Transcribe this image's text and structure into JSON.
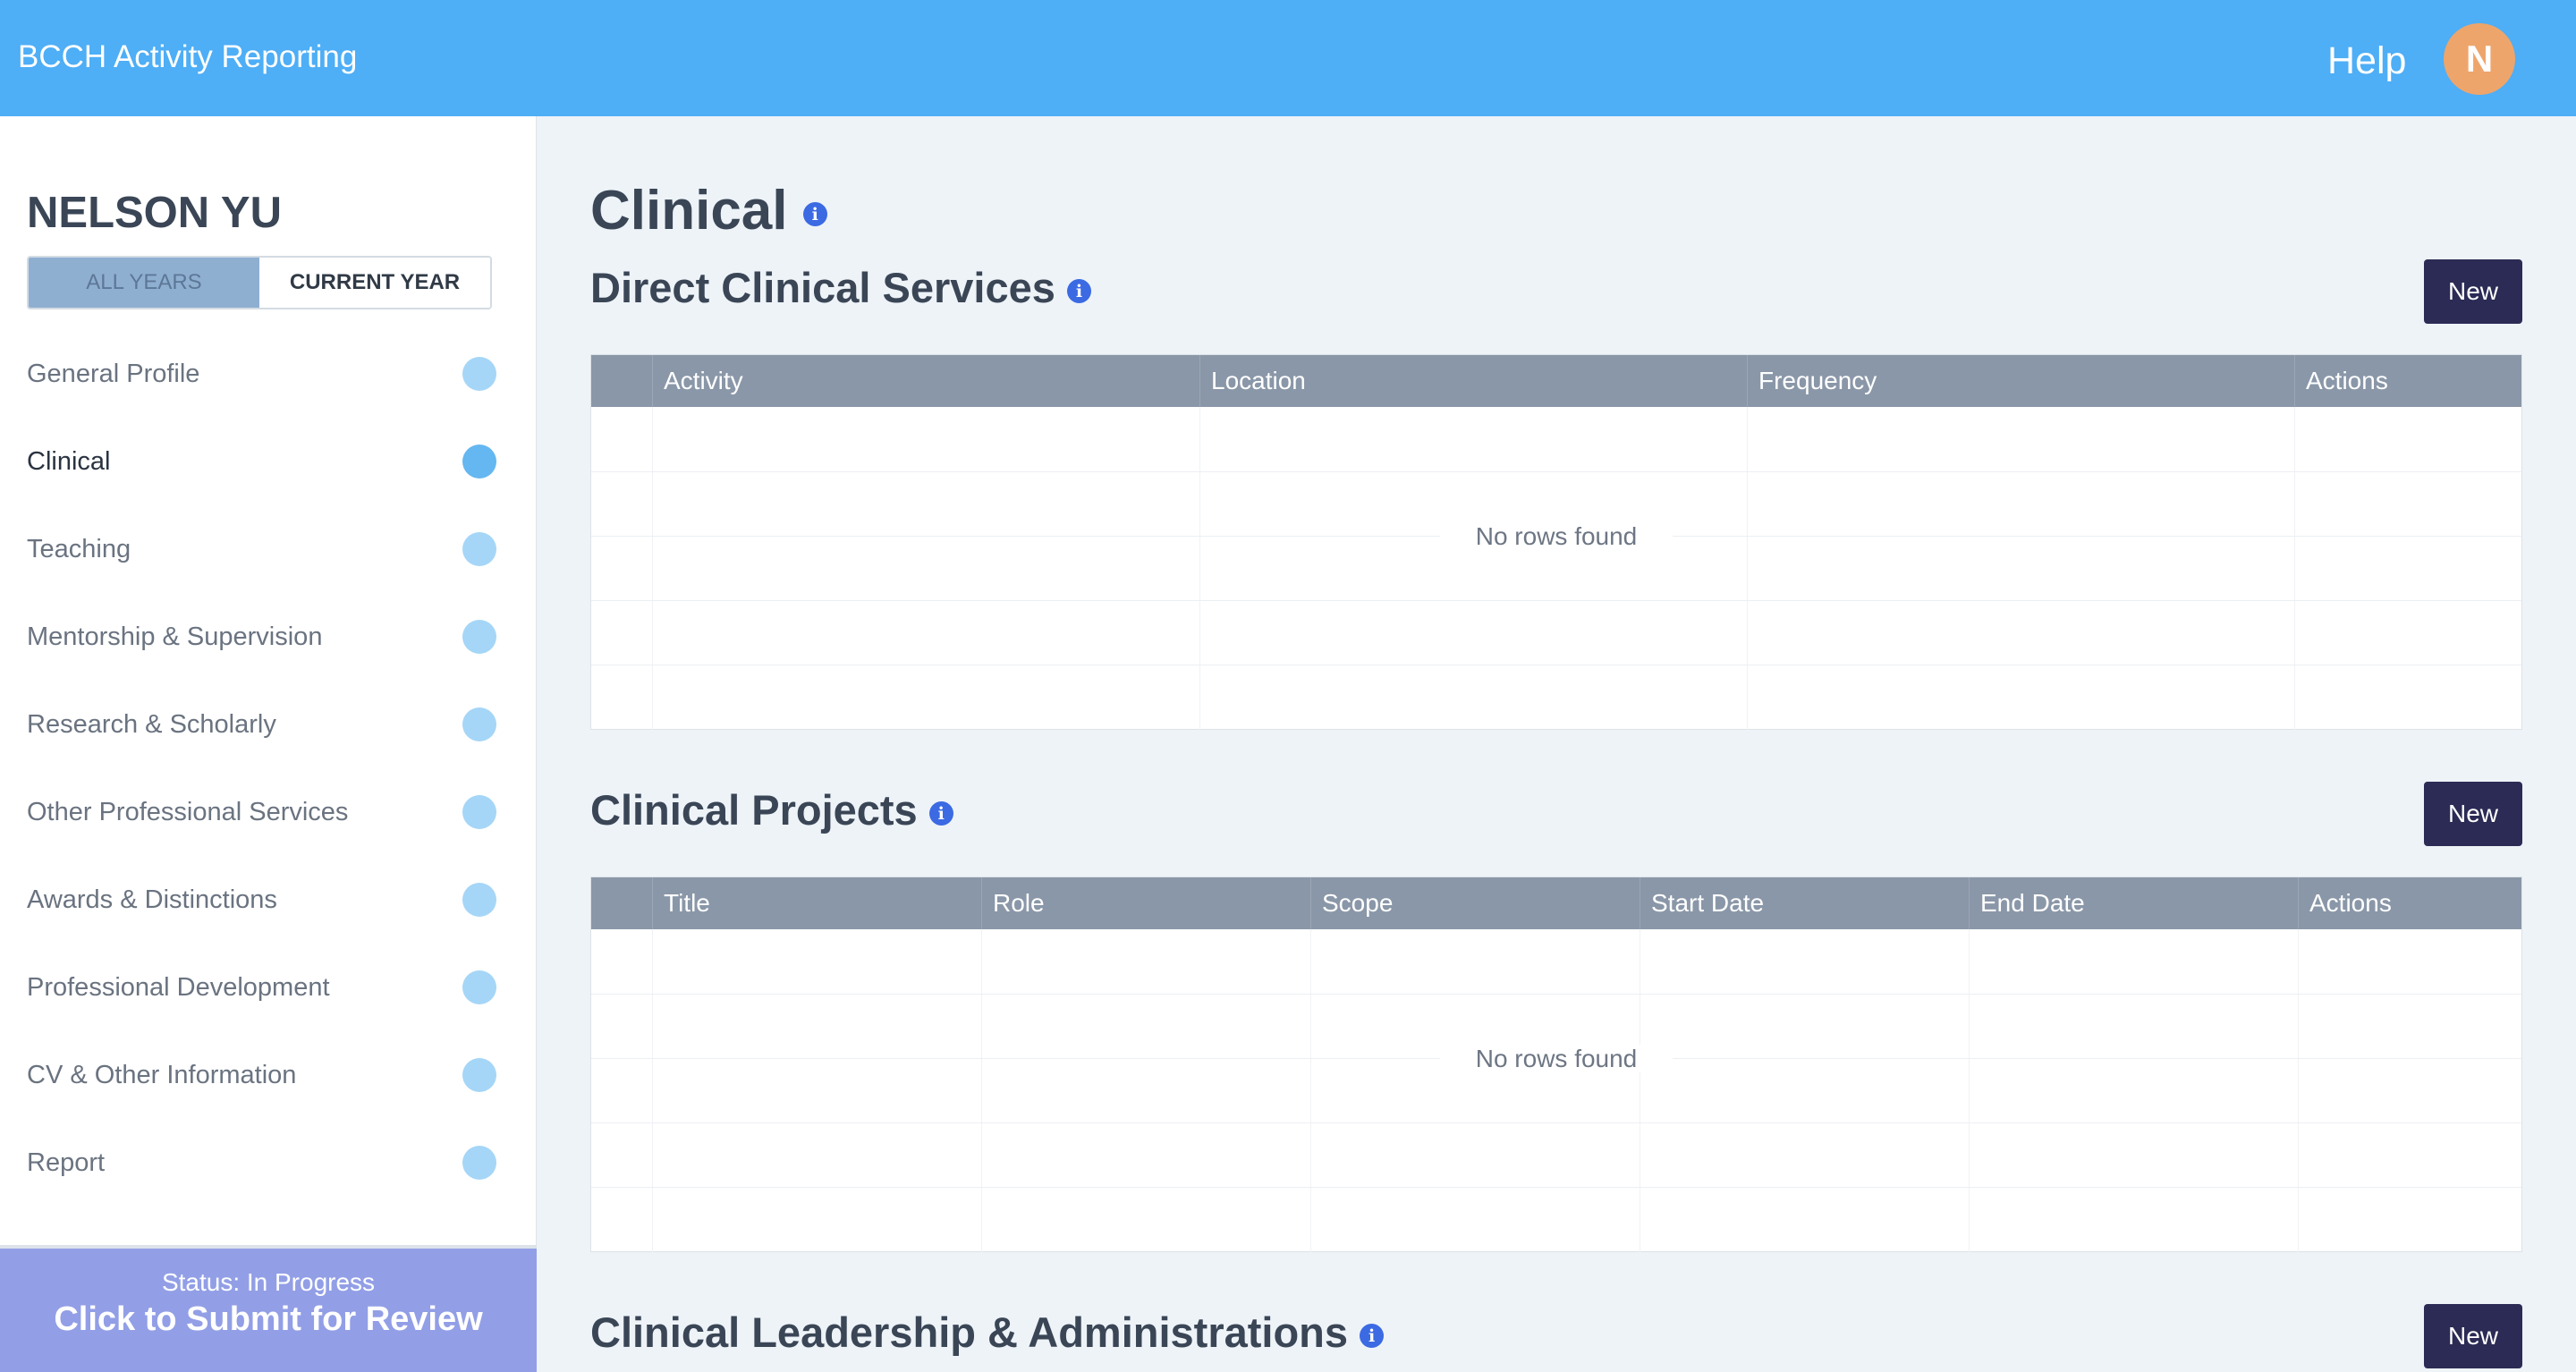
{
  "header": {
    "app_title": "BCCH Activity Reporting",
    "help_label": "Help",
    "avatar_initial": "N"
  },
  "sidebar": {
    "user_name": "NELSON YU",
    "year_toggle": {
      "all_years": "ALL YEARS",
      "current_year": "CURRENT YEAR",
      "selected": "ALL YEARS"
    },
    "items": [
      {
        "label": "General Profile"
      },
      {
        "label": "Clinical",
        "current": true
      },
      {
        "label": "Teaching"
      },
      {
        "label": "Mentorship & Supervision"
      },
      {
        "label": "Research & Scholarly"
      },
      {
        "label": "Other Professional Services"
      },
      {
        "label": "Awards & Distinctions"
      },
      {
        "label": "Professional Development"
      },
      {
        "label": "CV & Other Information"
      },
      {
        "label": "Report"
      }
    ],
    "submit": {
      "status": "Status: In Progress",
      "action": "Click to Submit for Review"
    }
  },
  "main": {
    "page_title": "Clinical",
    "info_glyph": "i",
    "sections": [
      {
        "title": "Direct Clinical Services",
        "new_label": "New",
        "columns": [
          "Activity",
          "Location",
          "Frequency",
          "Actions"
        ],
        "empty_message": "No rows found"
      },
      {
        "title": "Clinical Projects",
        "new_label": "New",
        "columns": [
          "Title",
          "Role",
          "Scope",
          "Start Date",
          "End Date",
          "Actions"
        ],
        "empty_message": "No rows found"
      },
      {
        "title": "Clinical Leadership & Administrations",
        "new_label": "New"
      }
    ]
  },
  "colors": {
    "topbar": "#4eaef6",
    "avatar": "#eea56b",
    "new_button": "#2b2b55",
    "grid_header": "#8a97a8",
    "submit_panel": "#929fe6",
    "info_icon": "#3b6ae3",
    "nav_dot": "#a5d6f7",
    "nav_dot_current": "#64b7f0"
  }
}
